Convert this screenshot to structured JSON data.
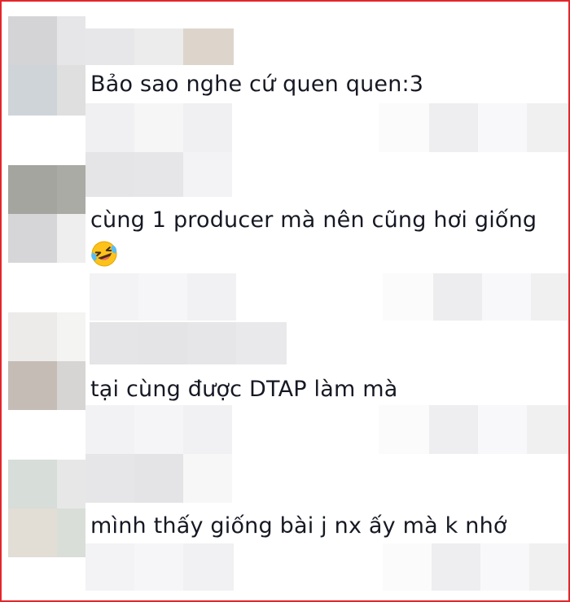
{
  "comments": [
    {
      "text": "Bảo sao nghe cứ quen quen:3"
    },
    {
      "text": "cùng 1 producer mà nên cũng hơi giống",
      "emoji": "laughing-tears-emoji"
    },
    {
      "text": "tại cùng được DTAP làm mà"
    },
    {
      "text": "mình thấy giống bài j nx ấy mà k nhớ"
    }
  ],
  "colors": {
    "frame_border": "#e3262b",
    "text": "#161823"
  }
}
